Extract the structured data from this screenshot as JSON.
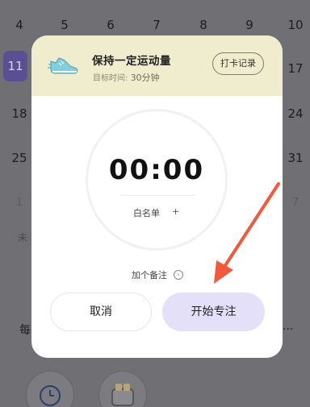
{
  "calendar": {
    "row1": [
      "4",
      "5",
      "6",
      "7",
      "8",
      "9",
      "10"
    ],
    "row2_left": "11",
    "row2_right": "17",
    "row3_left": "18",
    "row3_right": "24",
    "row4_left": "25",
    "row4_right": "31",
    "row5_left": "1",
    "row5_right": "7",
    "partial_text_left": "未",
    "partial_text_bottom": "每",
    "partial_text_ellipsis": "..."
  },
  "task": {
    "title": "保持一定运动量",
    "target_label": "目标时间:",
    "target_value": "30分钟",
    "checkin_label": "打卡记录"
  },
  "timer": {
    "display": "00:00",
    "whitelist_label": "白名单",
    "whitelist_add": "+"
  },
  "note": {
    "label": "加个备注",
    "arrow": "›"
  },
  "actions": {
    "cancel_label": "取消",
    "start_label": "开始专注"
  },
  "colors": {
    "header_bg": "#f0edcf",
    "start_button_bg": "#e4e0fa",
    "arrow_color": "#f2583c",
    "selected_day_bg": "#5a4f92"
  },
  "icons": {
    "shoe": "running-shoe-icon",
    "clock": "clock-icon",
    "toaster": "toaster-icon"
  }
}
